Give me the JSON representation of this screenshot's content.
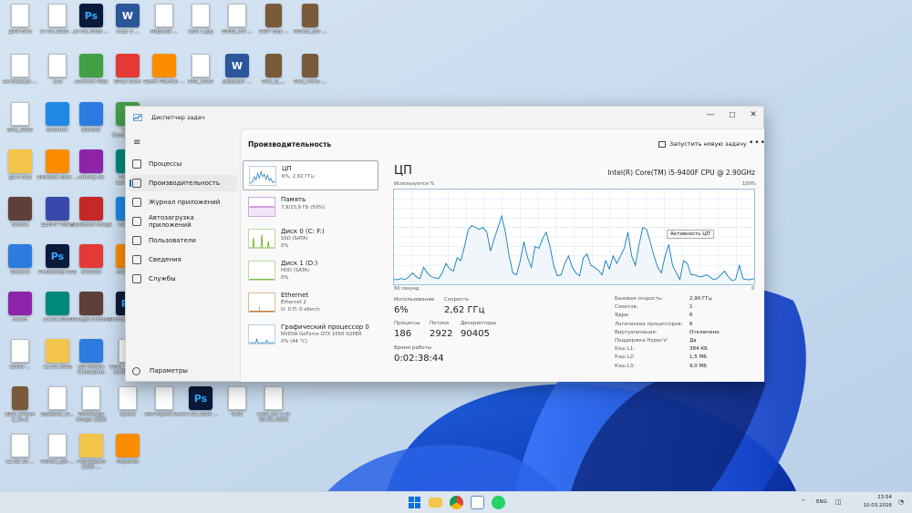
{
  "window": {
    "title": "Диспетчер задач",
    "minimize": "—",
    "maximize": "☐",
    "close": "✕"
  },
  "nav": {
    "items": [
      {
        "label": "Процессы",
        "icon": "processes-icon"
      },
      {
        "label": "Производительность",
        "icon": "performance-icon",
        "active": true
      },
      {
        "label": "Журнал приложений",
        "icon": "app-history-icon"
      },
      {
        "label": "Автозагрузка приложений",
        "icon": "startup-icon"
      },
      {
        "label": "Пользователи",
        "icon": "users-icon"
      },
      {
        "label": "Сведения",
        "icon": "details-icon"
      },
      {
        "label": "Службы",
        "icon": "services-icon"
      }
    ],
    "settings": "Параметры"
  },
  "header": {
    "title": "Производительность",
    "new_task": "Запустить новую задачу",
    "more": "•••"
  },
  "resources": [
    {
      "name": "ЦП",
      "sub1": "6%, 2,62 ГГц",
      "sub2": "",
      "color": "#117dbb"
    },
    {
      "name": "Память",
      "sub1": "7,9/15,9 ГБ (50%)",
      "sub2": "",
      "color": "#8b12ae"
    },
    {
      "name": "Диск 0 (C: F:)",
      "sub1": "SSD (SATA)",
      "sub2": "0%",
      "color": "#4da60c"
    },
    {
      "name": "Диск 1 (D:)",
      "sub1": "HDD (SATA)",
      "sub2": "0%",
      "color": "#4da60c"
    },
    {
      "name": "Ethernet",
      "sub1": "Ethernet 2",
      "sub2": "О: 0 П: 0 кбит/с",
      "color": "#a74f01"
    },
    {
      "name": "Графический процессор 0",
      "sub1": "NVIDIA GeForce GTX 1650 SUPER",
      "sub2": "0% (44 °C)",
      "color": "#117dbb"
    }
  ],
  "cpu": {
    "title": "ЦП",
    "model": "Intel(R) Core(TM) i5-9400F CPU @ 2.90GHz",
    "graph_label": "Используется %",
    "graph_max": "100%",
    "graph_span": "60 секунд",
    "graph_min": "0",
    "tooltip": "Активность ЦП",
    "utilization_samples_percent": [
      5,
      5,
      6,
      5,
      8,
      12,
      8,
      6,
      18,
      12,
      8,
      7,
      6,
      12,
      22,
      16,
      14,
      28,
      25,
      40,
      58,
      62,
      60,
      58,
      60,
      55,
      35,
      48,
      60,
      72,
      55,
      30,
      12,
      10,
      25,
      45,
      28,
      18,
      40,
      38,
      48,
      55,
      40,
      20,
      9,
      10,
      22,
      30,
      18,
      12,
      9,
      28,
      32,
      20,
      18,
      15,
      10,
      25,
      16,
      30,
      22,
      30,
      38,
      55,
      30,
      20,
      42,
      60,
      58,
      45,
      30,
      18,
      12,
      30,
      42,
      20,
      12,
      5,
      25,
      22,
      10,
      10,
      8,
      8,
      10,
      8,
      5,
      6,
      10,
      14,
      8,
      4,
      5,
      20,
      6,
      5,
      5,
      6
    ]
  },
  "stats": {
    "utilization_label": "Использование",
    "utilization": "6%",
    "speed_label": "Скорость",
    "speed": "2,62 ГГц",
    "processes_label": "Процессы",
    "processes": "186",
    "threads_label": "Потоки",
    "threads": "2922",
    "handles_label": "Дескрипторы",
    "handles": "90405",
    "uptime_label": "Время работы",
    "uptime": "0:02:38:44"
  },
  "specs": [
    {
      "label": "Базовая скорость:",
      "value": "2,90 ГГц"
    },
    {
      "label": "Сокетов:",
      "value": "1"
    },
    {
      "label": "Ядра:",
      "value": "6"
    },
    {
      "label": "Логических процессоров:",
      "value": "6"
    },
    {
      "label": "Виртуализация:",
      "value": "Отключено"
    },
    {
      "label": "Поддержка Hyper-V:",
      "value": "Да"
    },
    {
      "label": "Кэш L1:",
      "value": "384 КБ"
    },
    {
      "label": "Кэш L2:",
      "value": "1,5 МБ"
    },
    {
      "label": "Кэш L3:",
      "value": "9,0 МБ"
    }
  ],
  "desktop": {
    "icons": [
      {
        "label": "ДЛЯ ВСЁ",
        "kind": "doc"
      },
      {
        "label": "27.01.2026 ...",
        "kind": "doc"
      },
      {
        "label": "27.01.2026 ...",
        "kind": "ps"
      },
      {
        "label": "ссср 3 ...",
        "kind": "word"
      },
      {
        "label": "Мирный ...",
        "kind": "doc"
      },
      {
        "label": "(20) 1.jpg",
        "kind": "doc"
      },
      {
        "label": "SSHD_ant ...",
        "kind": "doc"
      },
      {
        "label": "1997 Buy ...",
        "kind": "book"
      },
      {
        "label": "Polnoe_pol ...",
        "kind": "book"
      },
      {
        "label": "Активация ...",
        "kind": "doc"
      },
      {
        "label": "123",
        "kind": "doc"
      },
      {
        "label": "uTorrent Web",
        "kind": "app"
      },
      {
        "label": "QPLA Scan",
        "kind": "app"
      },
      {
        "label": "Room Planner ...",
        "kind": "app"
      },
      {
        "label": "IMG_2020",
        "kind": "doc"
      },
      {
        "label": "реферат ...",
        "kind": "word"
      },
      {
        "label": "Otis_B_...",
        "kind": "book"
      },
      {
        "label": "Max_Fortu ...",
        "kind": "book"
      },
      {
        "label": "ВСЁ_2026",
        "kind": "doc"
      },
      {
        "label": "Блокнот",
        "kind": "app"
      },
      {
        "label": "Blender",
        "kind": "app"
      },
      {
        "label": "Total Commander",
        "kind": "app"
      },
      {
        "label": "ДСЛ ВСЁ",
        "kind": "folder"
      },
      {
        "label": "Ultimate Boot ...",
        "kind": "app"
      },
      {
        "label": "Among Us",
        "kind": "app"
      },
      {
        "label": "Pointer Launcher",
        "kind": "app"
      },
      {
        "label": "Yandex",
        "kind": "app"
      },
      {
        "label": "ЦЕНТР Video",
        "kind": "app"
      },
      {
        "label": "FastStone Image",
        "kind": "app"
      },
      {
        "label": "CapCut",
        "kind": "app"
      },
      {
        "label": "Discord",
        "kind": "app"
      },
      {
        "label": "Photoshop CS6",
        "kind": "ps"
      },
      {
        "label": "ACDSee",
        "kind": "app"
      },
      {
        "label": "AnyDesk",
        "kind": "app"
      },
      {
        "label": "oCam",
        "kind": "app"
      },
      {
        "label": "13.02.2026",
        "kind": "app"
      },
      {
        "label": "Google Chrome",
        "kind": "app"
      },
      {
        "label": "Photoshop CS6",
        "kind": "ps"
      },
      {
        "label": "LOGO ...",
        "kind": "doc"
      },
      {
        "label": "13.02.2026",
        "kind": "folder"
      },
      {
        "label": "Sid Meiers Civilization",
        "kind": "app"
      },
      {
        "label": "CMR_инв 6 от 10.02.2026",
        "kind": "doc"
      },
      {
        "label": "BDR_Dnevn 2_ch-2",
        "kind": "book"
      },
      {
        "label": "Dyakova_N...",
        "kind": "doc"
      },
      {
        "label": "WhatsApp Image 2026",
        "kind": "doc"
      },
      {
        "label": "архив",
        "kind": "doc"
      },
      {
        "label": "МИ Маркетинг",
        "kind": "doc"
      },
      {
        "label": "27.01.2026 ...",
        "kind": "ps"
      },
      {
        "label": "0,92",
        "kind": "doc"
      },
      {
        "label": "CMR_inv 2 of 09.02.2026",
        "kind": "doc"
      },
      {
        "label": "11.02 26 ...",
        "kind": "doc"
      },
      {
        "label": "Polnoe_pol ...",
        "kind": "doc"
      },
      {
        "label": "География 2026 ...",
        "kind": "folder"
      },
      {
        "label": "Корзина",
        "kind": "app"
      }
    ]
  },
  "taskbar": {
    "language": "ENG",
    "time": "23:54",
    "date": "10.03.2026"
  }
}
